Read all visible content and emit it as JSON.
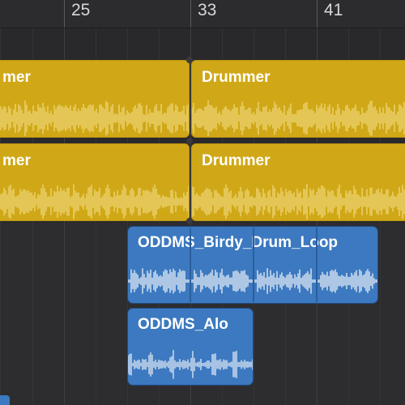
{
  "ruler": {
    "bars": [
      "25",
      "33",
      "41"
    ]
  },
  "regions": {
    "drummer_row1_left": "mer",
    "drummer_row1_right": "Drummer",
    "drummer_row2_left": "mer",
    "drummer_row2_right": "Drummer",
    "audio_loop": "ODDMS_Birdy_Drum_Loop",
    "audio_alo": "ODDMS_Alo"
  },
  "colors": {
    "drummer_region": "#d0a817",
    "audio_region": "#3c79c0",
    "waveform_drummer": "#f3df8a",
    "waveform_audio": "#ffffff"
  }
}
